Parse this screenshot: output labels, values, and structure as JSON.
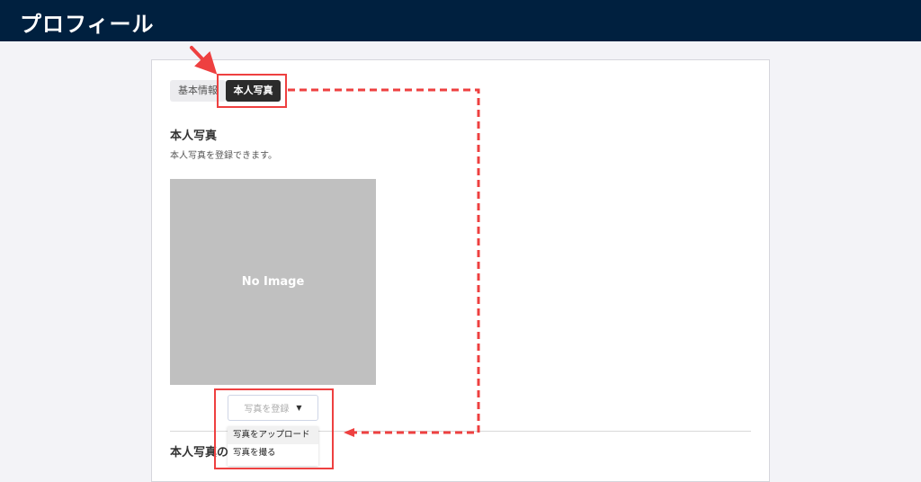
{
  "header": {
    "title": "プロフィール"
  },
  "tabs": [
    {
      "label": "基本情報",
      "active": false
    },
    {
      "label": "本人写真",
      "active": true
    }
  ],
  "section": {
    "title": "本人写真",
    "description": "本人写真を登録できます。"
  },
  "photo": {
    "placeholder": "No Image"
  },
  "register_button": {
    "label": "写真を登録",
    "icon": "caret-down-icon"
  },
  "dropdown": {
    "items": [
      {
        "label": "写真をアップロード"
      },
      {
        "label": "写真を撮る"
      }
    ]
  },
  "section2": {
    "title": "本人写真の"
  },
  "colors": {
    "header_bg": "#00203f",
    "annotation": "#ee4040",
    "active_tab": "#2b2b2b"
  }
}
